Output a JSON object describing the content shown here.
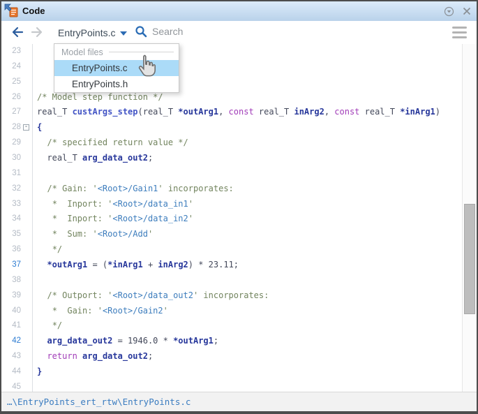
{
  "window": {
    "title": "Code"
  },
  "toolbar": {
    "file_selector_value": "EntryPoints.c",
    "search_placeholder": "Search"
  },
  "dropdown": {
    "header": "Model files",
    "items": [
      {
        "label": "EntryPoints.c",
        "selected": true
      },
      {
        "label": "EntryPoints.h",
        "selected": false
      }
    ]
  },
  "editor": {
    "first_line": 23,
    "last_line": 45,
    "highlighted_lines": [
      37,
      42
    ],
    "lines": [
      {
        "n": 23,
        "seg": []
      },
      {
        "n": 24,
        "seg": []
      },
      {
        "n": 25,
        "seg": []
      },
      {
        "n": 26,
        "seg": [
          {
            "c": "cm",
            "t": "/* Model step function */"
          }
        ]
      },
      {
        "n": 27,
        "seg": [
          {
            "c": "pl",
            "t": "real_T "
          },
          {
            "c": "fn",
            "t": "custArgs_step"
          },
          {
            "c": "pl",
            "t": "(real_T "
          },
          {
            "c": "id",
            "t": "*outArg1"
          },
          {
            "c": "pl",
            "t": ", "
          },
          {
            "c": "kw",
            "t": "const"
          },
          {
            "c": "pl",
            "t": " real_T "
          },
          {
            "c": "id",
            "t": "inArg2"
          },
          {
            "c": "pl",
            "t": ", "
          },
          {
            "c": "kw",
            "t": "const"
          },
          {
            "c": "pl",
            "t": " real_T "
          },
          {
            "c": "id",
            "t": "*inArg1"
          },
          {
            "c": "pl",
            "t": ")"
          }
        ]
      },
      {
        "n": 28,
        "fold": true,
        "seg": [
          {
            "c": "id",
            "t": "{"
          }
        ]
      },
      {
        "n": 29,
        "seg": [
          {
            "c": "pl",
            "t": "  "
          },
          {
            "c": "cm",
            "t": "/* specified return value */"
          }
        ]
      },
      {
        "n": 30,
        "seg": [
          {
            "c": "pl",
            "t": "  real_T "
          },
          {
            "c": "id",
            "t": "arg_data_out2"
          },
          {
            "c": "pl",
            "t": ";"
          }
        ]
      },
      {
        "n": 31,
        "seg": []
      },
      {
        "n": 32,
        "seg": [
          {
            "c": "pl",
            "t": "  "
          },
          {
            "c": "cm",
            "t": "/* Gain: '"
          },
          {
            "c": "lk",
            "t": "<Root>/Gain1"
          },
          {
            "c": "cm",
            "t": "' incorporates:"
          }
        ]
      },
      {
        "n": 33,
        "seg": [
          {
            "c": "pl",
            "t": "   "
          },
          {
            "c": "cm",
            "t": "*  Inport: '"
          },
          {
            "c": "lk",
            "t": "<Root>/data_in1"
          },
          {
            "c": "cm",
            "t": "'"
          }
        ]
      },
      {
        "n": 34,
        "seg": [
          {
            "c": "pl",
            "t": "   "
          },
          {
            "c": "cm",
            "t": "*  Inport: '"
          },
          {
            "c": "lk",
            "t": "<Root>/data_in2"
          },
          {
            "c": "cm",
            "t": "'"
          }
        ]
      },
      {
        "n": 35,
        "seg": [
          {
            "c": "pl",
            "t": "   "
          },
          {
            "c": "cm",
            "t": "*  Sum: '"
          },
          {
            "c": "lk",
            "t": "<Root>/Add"
          },
          {
            "c": "cm",
            "t": "'"
          }
        ]
      },
      {
        "n": 36,
        "seg": [
          {
            "c": "pl",
            "t": "   "
          },
          {
            "c": "cm",
            "t": "*/"
          }
        ]
      },
      {
        "n": 37,
        "hl": true,
        "seg": [
          {
            "c": "pl",
            "t": "  "
          },
          {
            "c": "id",
            "t": "*outArg1"
          },
          {
            "c": "pl",
            "t": " = ("
          },
          {
            "c": "id",
            "t": "*inArg1"
          },
          {
            "c": "pl",
            "t": " + "
          },
          {
            "c": "id",
            "t": "inArg2"
          },
          {
            "c": "pl",
            "t": ") * 23.11;"
          }
        ]
      },
      {
        "n": 38,
        "seg": []
      },
      {
        "n": 39,
        "seg": [
          {
            "c": "pl",
            "t": "  "
          },
          {
            "c": "cm",
            "t": "/* Outport: '"
          },
          {
            "c": "lk",
            "t": "<Root>/data_out2"
          },
          {
            "c": "cm",
            "t": "' incorporates:"
          }
        ]
      },
      {
        "n": 40,
        "seg": [
          {
            "c": "pl",
            "t": "   "
          },
          {
            "c": "cm",
            "t": "*  Gain: '"
          },
          {
            "c": "lk",
            "t": "<Root>/Gain2"
          },
          {
            "c": "cm",
            "t": "'"
          }
        ]
      },
      {
        "n": 41,
        "seg": [
          {
            "c": "pl",
            "t": "   "
          },
          {
            "c": "cm",
            "t": "*/"
          }
        ]
      },
      {
        "n": 42,
        "hl": true,
        "seg": [
          {
            "c": "pl",
            "t": "  "
          },
          {
            "c": "id",
            "t": "arg_data_out2"
          },
          {
            "c": "pl",
            "t": " = 1946.0 * "
          },
          {
            "c": "id",
            "t": "*outArg1"
          },
          {
            "c": "pl",
            "t": ";"
          }
        ]
      },
      {
        "n": 43,
        "seg": [
          {
            "c": "pl",
            "t": "  "
          },
          {
            "c": "kw",
            "t": "return"
          },
          {
            "c": "pl",
            "t": " "
          },
          {
            "c": "id",
            "t": "arg_data_out2"
          },
          {
            "c": "pl",
            "t": ";"
          }
        ]
      },
      {
        "n": 44,
        "seg": [
          {
            "c": "id",
            "t": "}"
          }
        ]
      },
      {
        "n": 45,
        "seg": []
      }
    ]
  },
  "statusbar": {
    "path": "…\\EntryPoints_ert_rtw\\EntryPoints.c"
  },
  "colors": {
    "titlebar_top": "#dcebfa",
    "titlebar_bottom": "#b9d2ea",
    "selection_bg": "#abdbf8",
    "accent_blue": "#2a6cb5",
    "comment": "#72845e",
    "link": "#3d7dbd",
    "keyword": "#a13cb8",
    "identifier": "#27379b",
    "function_name": "#4254c5",
    "plain": "#43485a",
    "line_number": "#b4bbc5",
    "line_number_active": "#2c7bd1",
    "status_text": "#3a7cc0"
  }
}
